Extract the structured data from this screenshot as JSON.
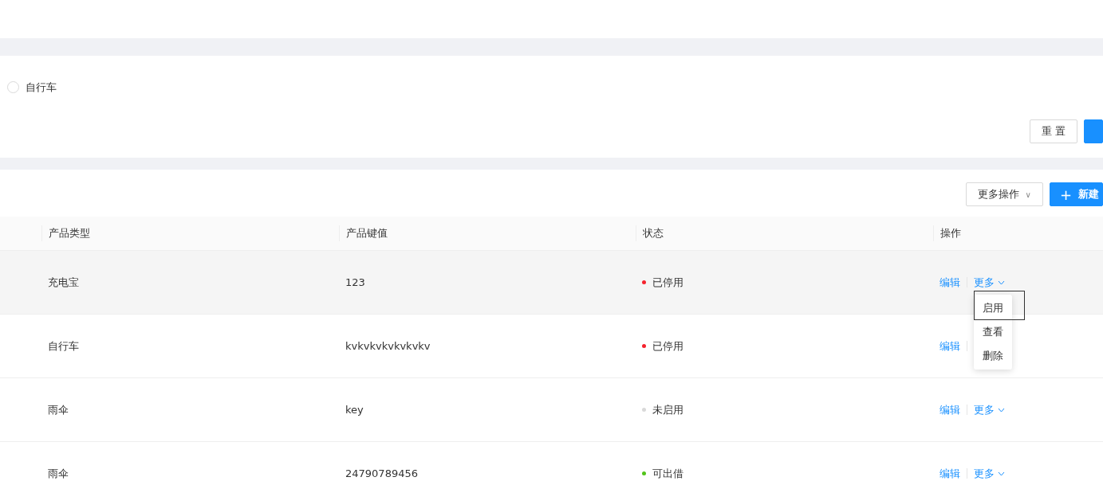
{
  "filter": {
    "radio": {
      "label": "自行车",
      "checked": false
    },
    "buttons": [
      {
        "label": "重 置",
        "kind": "default"
      },
      {
        "kind": "primary"
      }
    ]
  },
  "toolbar": {
    "more_button": {
      "label": "更多操作",
      "caret": "∨"
    },
    "new_button": {
      "icon": "+",
      "label": "新建"
    }
  },
  "table": {
    "columns": [
      "产品类型",
      "产品键值",
      "状态",
      "操作"
    ],
    "rows": [
      {
        "type": "充电宝",
        "key": "123",
        "status": "已停用",
        "color": "#f5222d",
        "edit": "编辑",
        "more": "更多",
        "menu_open": true
      },
      {
        "type": "自行车",
        "key": "kvkvkvkvkvkvkv",
        "status": "已停用",
        "color": "#f5222d",
        "edit": "编辑",
        "menu_open": false
      },
      {
        "type": "雨伞",
        "key": "key",
        "status": "未启用",
        "color": "#d9d9d9",
        "edit": "编辑",
        "more": "更多"
      },
      {
        "type": "雨伞",
        "key": "24790789456",
        "status": "可出借",
        "color": "#52c41a",
        "edit": "编辑",
        "more": "更多"
      }
    ]
  },
  "dropdown": {
    "items": [
      {
        "label": "启用",
        "selected": true
      },
      {
        "label": "查看",
        "selected": false
      },
      {
        "label": "删除",
        "selected": false
      }
    ]
  }
}
